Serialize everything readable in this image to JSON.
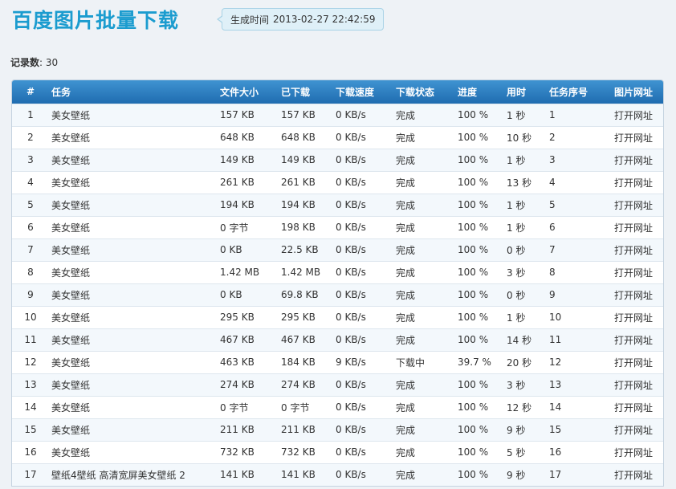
{
  "header": {
    "title": "百度图片批量下载",
    "gen_label": "生成时间",
    "gen_time": "2013-02-27 22:42:59"
  },
  "summary": {
    "count_label": "记录数",
    "count_value": "30"
  },
  "table": {
    "columns": [
      "#",
      "任务",
      "文件大小",
      "已下载",
      "下载速度",
      "下载状态",
      "进度",
      "用时",
      "任务序号",
      "图片网址"
    ],
    "rows": [
      {
        "idx": "1",
        "task": "美女壁纸",
        "size": "157 KB",
        "downloaded": "157 KB",
        "speed": "0 KB/s",
        "status": "完成",
        "progress": "100 %",
        "time": "1 秒",
        "task_id": "1",
        "url": "打开网址"
      },
      {
        "idx": "2",
        "task": "美女壁纸",
        "size": "648 KB",
        "downloaded": "648 KB",
        "speed": "0 KB/s",
        "status": "完成",
        "progress": "100 %",
        "time": "10 秒",
        "task_id": "2",
        "url": "打开网址"
      },
      {
        "idx": "3",
        "task": "美女壁纸",
        "size": "149 KB",
        "downloaded": "149 KB",
        "speed": "0 KB/s",
        "status": "完成",
        "progress": "100 %",
        "time": "1 秒",
        "task_id": "3",
        "url": "打开网址"
      },
      {
        "idx": "4",
        "task": "美女壁纸",
        "size": "261 KB",
        "downloaded": "261 KB",
        "speed": "0 KB/s",
        "status": "完成",
        "progress": "100 %",
        "time": "13 秒",
        "task_id": "4",
        "url": "打开网址"
      },
      {
        "idx": "5",
        "task": "美女壁纸",
        "size": "194 KB",
        "downloaded": "194 KB",
        "speed": "0 KB/s",
        "status": "完成",
        "progress": "100 %",
        "time": "1 秒",
        "task_id": "5",
        "url": "打开网址"
      },
      {
        "idx": "6",
        "task": "美女壁纸",
        "size": "0 字节",
        "downloaded": "198 KB",
        "speed": "0 KB/s",
        "status": "完成",
        "progress": "100 %",
        "time": "1 秒",
        "task_id": "6",
        "url": "打开网址"
      },
      {
        "idx": "7",
        "task": "美女壁纸",
        "size": "0 KB",
        "downloaded": "22.5 KB",
        "speed": "0 KB/s",
        "status": "完成",
        "progress": "100 %",
        "time": "0 秒",
        "task_id": "7",
        "url": "打开网址"
      },
      {
        "idx": "8",
        "task": "美女壁纸",
        "size": "1.42 MB",
        "downloaded": "1.42 MB",
        "speed": "0 KB/s",
        "status": "完成",
        "progress": "100 %",
        "time": "3 秒",
        "task_id": "8",
        "url": "打开网址"
      },
      {
        "idx": "9",
        "task": "美女壁纸",
        "size": "0 KB",
        "downloaded": "69.8 KB",
        "speed": "0 KB/s",
        "status": "完成",
        "progress": "100 %",
        "time": "0 秒",
        "task_id": "9",
        "url": "打开网址"
      },
      {
        "idx": "10",
        "task": "美女壁纸",
        "size": "295 KB",
        "downloaded": "295 KB",
        "speed": "0 KB/s",
        "status": "完成",
        "progress": "100 %",
        "time": "1 秒",
        "task_id": "10",
        "url": "打开网址"
      },
      {
        "idx": "11",
        "task": "美女壁纸",
        "size": "467 KB",
        "downloaded": "467 KB",
        "speed": "0 KB/s",
        "status": "完成",
        "progress": "100 %",
        "time": "14 秒",
        "task_id": "11",
        "url": "打开网址"
      },
      {
        "idx": "12",
        "task": "美女壁纸",
        "size": "463 KB",
        "downloaded": "184 KB",
        "speed": "9 KB/s",
        "status": "下载中",
        "progress": "39.7 %",
        "time": "20 秒",
        "task_id": "12",
        "url": "打开网址"
      },
      {
        "idx": "13",
        "task": "美女壁纸",
        "size": "274 KB",
        "downloaded": "274 KB",
        "speed": "0 KB/s",
        "status": "完成",
        "progress": "100 %",
        "time": "3 秒",
        "task_id": "13",
        "url": "打开网址"
      },
      {
        "idx": "14",
        "task": "美女壁纸",
        "size": "0 字节",
        "downloaded": "0 字节",
        "speed": "0 KB/s",
        "status": "完成",
        "progress": "100 %",
        "time": "12 秒",
        "task_id": "14",
        "url": "打开网址"
      },
      {
        "idx": "15",
        "task": "美女壁纸",
        "size": "211 KB",
        "downloaded": "211 KB",
        "speed": "0 KB/s",
        "status": "完成",
        "progress": "100 %",
        "time": "9 秒",
        "task_id": "15",
        "url": "打开网址"
      },
      {
        "idx": "16",
        "task": "美女壁纸",
        "size": "732 KB",
        "downloaded": "732 KB",
        "speed": "0 KB/s",
        "status": "完成",
        "progress": "100 %",
        "time": "5 秒",
        "task_id": "16",
        "url": "打开网址"
      },
      {
        "idx": "17",
        "task": "壁纸4壁纸 高清宽屏美女壁纸 2",
        "size": "141 KB",
        "downloaded": "141 KB",
        "speed": "0 KB/s",
        "status": "完成",
        "progress": "100 %",
        "time": "9 秒",
        "task_id": "17",
        "url": "打开网址"
      }
    ]
  },
  "colors": {
    "title": "#1b9ccf",
    "header_bg": "#2b7cc0",
    "page_bg": "#eef2f6",
    "row_alt": "#f3f8fc"
  }
}
